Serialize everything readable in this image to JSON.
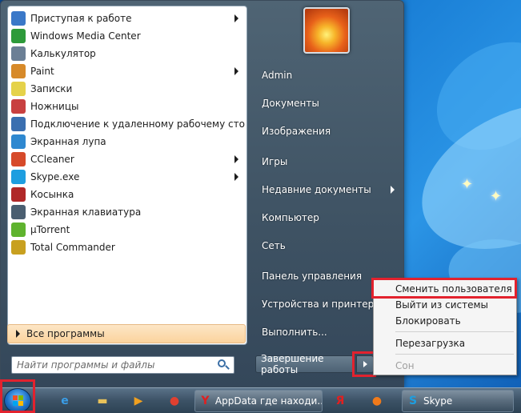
{
  "programs": [
    {
      "label": "Приступая к работе",
      "icon": "getting-started-icon",
      "color": "#3a78c8",
      "submenu": true
    },
    {
      "label": "Windows Media Center",
      "icon": "media-center-icon",
      "color": "#2d9a3a",
      "submenu": false
    },
    {
      "label": "Калькулятор",
      "icon": "calculator-icon",
      "color": "#6b7f95",
      "submenu": false
    },
    {
      "label": "Paint",
      "icon": "paint-icon",
      "color": "#d78a2a",
      "submenu": true
    },
    {
      "label": "Записки",
      "icon": "sticky-notes-icon",
      "color": "#e5d24a",
      "submenu": false
    },
    {
      "label": "Ножницы",
      "icon": "snipping-tool-icon",
      "color": "#c84040",
      "submenu": false
    },
    {
      "label": "Подключение к удаленному рабочему сто...",
      "icon": "remote-desktop-icon",
      "color": "#3a6fb0",
      "submenu": false
    },
    {
      "label": "Экранная лупа",
      "icon": "magnifier-icon",
      "color": "#2e88d0",
      "submenu": false
    },
    {
      "label": "CCleaner",
      "icon": "ccleaner-icon",
      "color": "#d64a2a",
      "submenu": true
    },
    {
      "label": "Skype.exe",
      "icon": "skype-icon",
      "color": "#1e9ee0",
      "submenu": true
    },
    {
      "label": "Косынка",
      "icon": "solitaire-icon",
      "color": "#b02828",
      "submenu": false
    },
    {
      "label": "Экранная клавиатура",
      "icon": "onscreen-keyboard-icon",
      "color": "#4a5e70",
      "submenu": false
    },
    {
      "label": "µTorrent",
      "icon": "utorrent-icon",
      "color": "#5fb32e",
      "submenu": false
    },
    {
      "label": "Total Commander",
      "icon": "total-commander-icon",
      "color": "#c8a020",
      "submenu": false
    }
  ],
  "all_programs": "Все программы",
  "search_placeholder": "Найти программы и файлы",
  "right_items": [
    {
      "label": "Admin",
      "submenu": false
    },
    {
      "label": "Документы",
      "submenu": false
    },
    {
      "label": "Изображения",
      "submenu": false
    },
    {
      "label": "Игры",
      "submenu": false
    },
    {
      "label": "Недавние документы",
      "submenu": true
    },
    {
      "label": "Компьютер",
      "submenu": false
    },
    {
      "label": "Сеть",
      "submenu": false
    },
    {
      "label": "Панель управления",
      "submenu": false
    },
    {
      "label": "Устройства и принтеры",
      "submenu": false
    },
    {
      "label": "Выполнить...",
      "submenu": false
    }
  ],
  "shutdown_label": "Завершение работы",
  "shutdown_menu": [
    {
      "label": "Сменить пользователя",
      "disabled": false
    },
    {
      "label": "Выйти из системы",
      "disabled": false
    },
    {
      "label": "Блокировать",
      "disabled": false
    },
    {
      "label": "Перезагрузка",
      "disabled": false
    },
    {
      "label": "Сон",
      "disabled": true
    }
  ],
  "taskbar": {
    "pinned": [
      {
        "name": "internet-explorer-icon",
        "glyph": "e",
        "color": "#3a9ee8"
      },
      {
        "name": "explorer-folder-icon",
        "glyph": "▬",
        "color": "#e8c25a"
      },
      {
        "name": "media-player-icon",
        "glyph": "▶",
        "color": "#f0a020"
      },
      {
        "name": "chrome-icon",
        "glyph": "●",
        "color": "#e04030"
      }
    ],
    "tasks": [
      {
        "label": "AppData где находи...",
        "glyph": "Y",
        "color": "#e02020"
      },
      {
        "label": "Skype",
        "glyph": "S",
        "color": "#1e9ee0"
      }
    ],
    "yandex_glyph": "Я",
    "firefox_glyph": "●"
  },
  "highlight_color": "#e2222e"
}
